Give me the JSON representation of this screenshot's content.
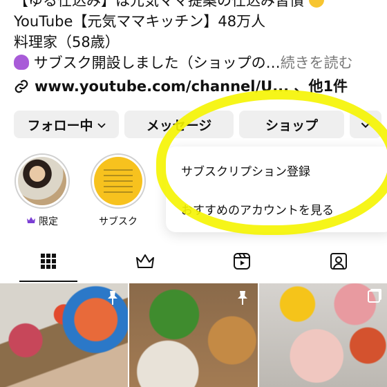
{
  "bio": {
    "line1": "【ゆる仕込み】は元気ママ提案の仕込み習慣",
    "line2": "YouTube【元気ママキッチン】48万人",
    "line3": "料理家（58歳）",
    "line4": "サブスク開設しました（ショップの…",
    "more": "続きを読む",
    "link": "www.youtube.com/channel/U... 、他1件"
  },
  "buttons": {
    "follow": "フォロー中",
    "message": "メッセージ",
    "shop": "ショップ"
  },
  "highlights": [
    {
      "label": "限定"
    },
    {
      "label": "サブスク"
    }
  ],
  "menu": {
    "items": [
      "サブスクリプション登録",
      "おすすめのアカウントを見る"
    ]
  },
  "colors": {
    "highlight_annotation": "#f5f400",
    "crown": "#7b3fd4",
    "more_text": "#7a7a7a"
  },
  "icons": [
    "grid-icon",
    "crown-icon",
    "reels-icon",
    "tagged-icon",
    "pin-icon",
    "multi-image-icon"
  ]
}
